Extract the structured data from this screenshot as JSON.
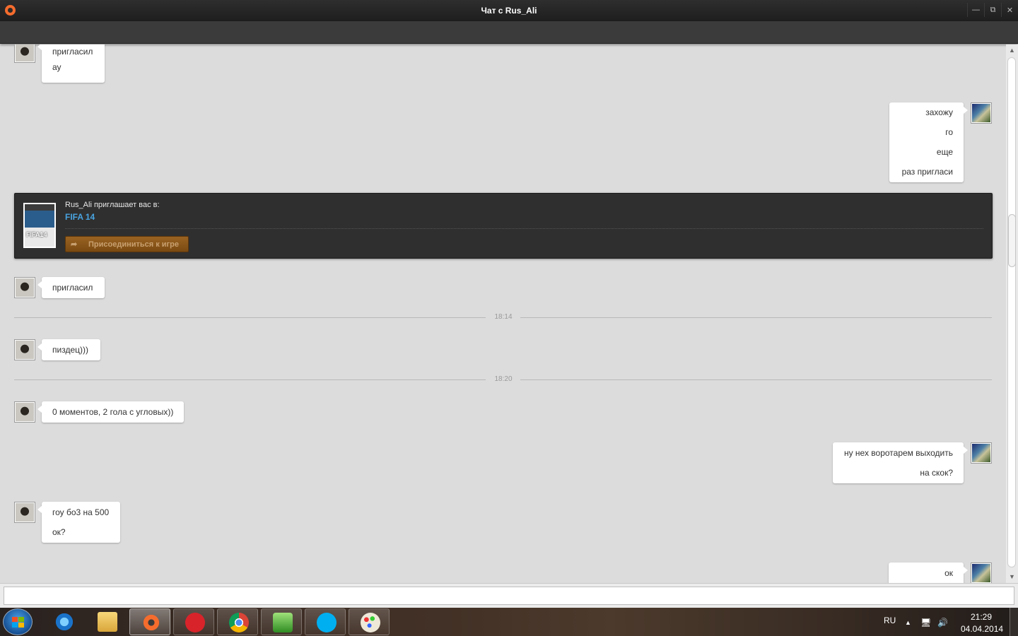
{
  "window": {
    "title": "Чат с Rus_Ali",
    "minimize_icon": "minimize-icon",
    "restore_icon": "restore-icon",
    "close_icon": "close-icon"
  },
  "messages": {
    "block1": {
      "lines": [
        "пригласил",
        "ау"
      ]
    },
    "block2": {
      "lines": [
        "захожу",
        "го",
        "еще",
        "раз пригласи"
      ]
    },
    "block3": {
      "lines": [
        "пригласил"
      ]
    },
    "block4": {
      "lines": [
        "пиздец)))"
      ]
    },
    "block5": {
      "lines": [
        "0 моментов, 2 гола с угловых))"
      ]
    },
    "block6": {
      "lines": [
        "ну нех воротарем выходить",
        "на скок?"
      ]
    },
    "block7": {
      "lines": [
        "гоу бо3 на 500",
        "ок?"
      ]
    },
    "block8": {
      "lines": [
        "ок"
      ]
    }
  },
  "timestamps": [
    "18:14",
    "18:20"
  ],
  "invite": {
    "lead": "Rus_Ali приглашает вас в:",
    "game": "FIFA 14",
    "cover_text": "FIFA14",
    "join_label": "Присоединиться к игре"
  },
  "input": {
    "value": "",
    "placeholder": ""
  },
  "taskbar": {
    "language": "RU",
    "time": "21:29",
    "date": "04.04.2014",
    "apps": [
      "start-button",
      "internet-explorer",
      "file-explorer",
      "origin",
      "fifa-14",
      "chrome",
      "utorrent",
      "skype",
      "paint"
    ]
  },
  "colors": {
    "chat_bg": "#dcdcdc",
    "titlebar": "#262626",
    "link_blue": "#49a3e0",
    "join_button": "#8a561a"
  }
}
